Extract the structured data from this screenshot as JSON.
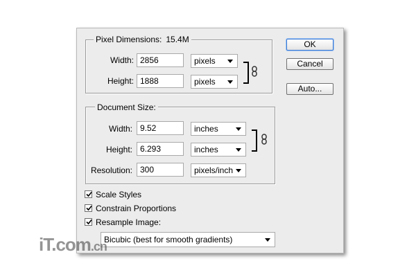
{
  "pixel_dimensions": {
    "title": "Pixel Dimensions:",
    "size_value": "15.4M",
    "width_label": "Width:",
    "width_value": "2856",
    "width_unit": "pixels",
    "height_label": "Height:",
    "height_value": "1888",
    "height_unit": "pixels"
  },
  "document_size": {
    "title": "Document Size:",
    "width_label": "Width:",
    "width_value": "9.52",
    "width_unit": "inches",
    "height_label": "Height:",
    "height_value": "6.293",
    "height_unit": "inches",
    "resolution_label": "Resolution:",
    "resolution_value": "300",
    "resolution_unit": "pixels/inch"
  },
  "options": {
    "scale_styles": {
      "label": "Scale Styles",
      "checked": true
    },
    "constrain_proportions": {
      "label": "Constrain Proportions",
      "checked": true
    },
    "resample_image": {
      "label": "Resample Image:",
      "checked": true
    },
    "resample_method": "Bicubic (best for smooth gradients)"
  },
  "buttons": {
    "ok": "OK",
    "cancel": "Cancel",
    "auto": "Auto..."
  },
  "icons": {
    "link": "chain-link-icon",
    "dropdown": "chevron-down-icon",
    "check": "checkmark-icon"
  },
  "watermark": {
    "text": "iT",
    "rest": ".com",
    "suffix": ".cn"
  }
}
